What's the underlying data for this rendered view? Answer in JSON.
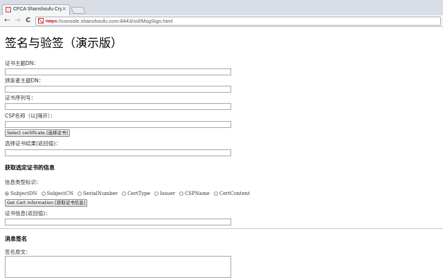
{
  "browser": {
    "tab_title": "CFCA Shanshoufu Crypto",
    "tab_close": "×",
    "back": "←",
    "forward": "→",
    "reload": "C",
    "url_scheme": "https",
    "url_rest": "://console.shanshoufu.com:8443/ssf/MsgSign.html"
  },
  "page": {
    "title": "签名与验签（演示版）",
    "cert_subject_label": "证书主题DN：",
    "issuer_subject_label": "颁发者主题DN：",
    "serial_label": "证书序列号：",
    "csp_label": "CSP名称（以|隔开）：",
    "select_cert_button": "Select certificate [选择证书]",
    "select_result_label": "选择证书结果(返回值)：",
    "cert_info_heading": "获取选定证书的信息",
    "info_type_label": "信息类型标识：",
    "info_types": [
      "SubjectDN",
      "SubjectCN",
      "SerialNumber",
      "CertType",
      "Issuer",
      "CSPName",
      "CertContent"
    ],
    "info_type_selected": "SubjectDN",
    "get_cert_button": "Get Cert Information [获取证书信息]",
    "cert_info_result_label": "证书信息(返回值)：",
    "msg_sign_heading": "消息签名",
    "plaintext_label": "签名原文："
  }
}
